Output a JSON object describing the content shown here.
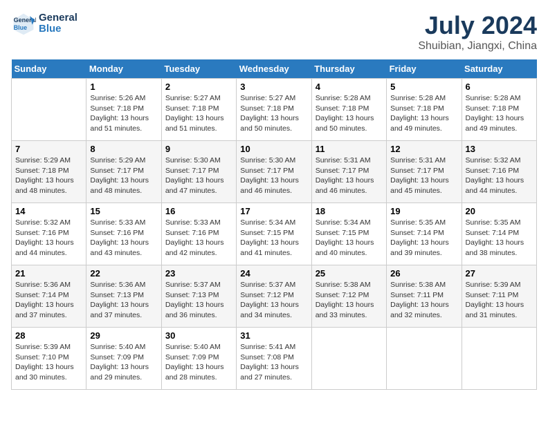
{
  "header": {
    "logo_line1": "General",
    "logo_line2": "Blue",
    "title": "July 2024",
    "subtitle": "Shuibian, Jiangxi, China"
  },
  "weekdays": [
    "Sunday",
    "Monday",
    "Tuesday",
    "Wednesday",
    "Thursday",
    "Friday",
    "Saturday"
  ],
  "weeks": [
    [
      null,
      {
        "day": "1",
        "sunrise": "5:26 AM",
        "sunset": "7:18 PM",
        "daylight": "13 hours and 51 minutes."
      },
      {
        "day": "2",
        "sunrise": "5:27 AM",
        "sunset": "7:18 PM",
        "daylight": "13 hours and 51 minutes."
      },
      {
        "day": "3",
        "sunrise": "5:27 AM",
        "sunset": "7:18 PM",
        "daylight": "13 hours and 50 minutes."
      },
      {
        "day": "4",
        "sunrise": "5:28 AM",
        "sunset": "7:18 PM",
        "daylight": "13 hours and 50 minutes."
      },
      {
        "day": "5",
        "sunrise": "5:28 AM",
        "sunset": "7:18 PM",
        "daylight": "13 hours and 49 minutes."
      },
      {
        "day": "6",
        "sunrise": "5:28 AM",
        "sunset": "7:18 PM",
        "daylight": "13 hours and 49 minutes."
      }
    ],
    [
      {
        "day": "7",
        "sunrise": "5:29 AM",
        "sunset": "7:18 PM",
        "daylight": "13 hours and 48 minutes."
      },
      {
        "day": "8",
        "sunrise": "5:29 AM",
        "sunset": "7:17 PM",
        "daylight": "13 hours and 48 minutes."
      },
      {
        "day": "9",
        "sunrise": "5:30 AM",
        "sunset": "7:17 PM",
        "daylight": "13 hours and 47 minutes."
      },
      {
        "day": "10",
        "sunrise": "5:30 AM",
        "sunset": "7:17 PM",
        "daylight": "13 hours and 46 minutes."
      },
      {
        "day": "11",
        "sunrise": "5:31 AM",
        "sunset": "7:17 PM",
        "daylight": "13 hours and 46 minutes."
      },
      {
        "day": "12",
        "sunrise": "5:31 AM",
        "sunset": "7:17 PM",
        "daylight": "13 hours and 45 minutes."
      },
      {
        "day": "13",
        "sunrise": "5:32 AM",
        "sunset": "7:16 PM",
        "daylight": "13 hours and 44 minutes."
      }
    ],
    [
      {
        "day": "14",
        "sunrise": "5:32 AM",
        "sunset": "7:16 PM",
        "daylight": "13 hours and 44 minutes."
      },
      {
        "day": "15",
        "sunrise": "5:33 AM",
        "sunset": "7:16 PM",
        "daylight": "13 hours and 43 minutes."
      },
      {
        "day": "16",
        "sunrise": "5:33 AM",
        "sunset": "7:16 PM",
        "daylight": "13 hours and 42 minutes."
      },
      {
        "day": "17",
        "sunrise": "5:34 AM",
        "sunset": "7:15 PM",
        "daylight": "13 hours and 41 minutes."
      },
      {
        "day": "18",
        "sunrise": "5:34 AM",
        "sunset": "7:15 PM",
        "daylight": "13 hours and 40 minutes."
      },
      {
        "day": "19",
        "sunrise": "5:35 AM",
        "sunset": "7:14 PM",
        "daylight": "13 hours and 39 minutes."
      },
      {
        "day": "20",
        "sunrise": "5:35 AM",
        "sunset": "7:14 PM",
        "daylight": "13 hours and 38 minutes."
      }
    ],
    [
      {
        "day": "21",
        "sunrise": "5:36 AM",
        "sunset": "7:14 PM",
        "daylight": "13 hours and 37 minutes."
      },
      {
        "day": "22",
        "sunrise": "5:36 AM",
        "sunset": "7:13 PM",
        "daylight": "13 hours and 37 minutes."
      },
      {
        "day": "23",
        "sunrise": "5:37 AM",
        "sunset": "7:13 PM",
        "daylight": "13 hours and 36 minutes."
      },
      {
        "day": "24",
        "sunrise": "5:37 AM",
        "sunset": "7:12 PM",
        "daylight": "13 hours and 34 minutes."
      },
      {
        "day": "25",
        "sunrise": "5:38 AM",
        "sunset": "7:12 PM",
        "daylight": "13 hours and 33 minutes."
      },
      {
        "day": "26",
        "sunrise": "5:38 AM",
        "sunset": "7:11 PM",
        "daylight": "13 hours and 32 minutes."
      },
      {
        "day": "27",
        "sunrise": "5:39 AM",
        "sunset": "7:11 PM",
        "daylight": "13 hours and 31 minutes."
      }
    ],
    [
      {
        "day": "28",
        "sunrise": "5:39 AM",
        "sunset": "7:10 PM",
        "daylight": "13 hours and 30 minutes."
      },
      {
        "day": "29",
        "sunrise": "5:40 AM",
        "sunset": "7:09 PM",
        "daylight": "13 hours and 29 minutes."
      },
      {
        "day": "30",
        "sunrise": "5:40 AM",
        "sunset": "7:09 PM",
        "daylight": "13 hours and 28 minutes."
      },
      {
        "day": "31",
        "sunrise": "5:41 AM",
        "sunset": "7:08 PM",
        "daylight": "13 hours and 27 minutes."
      },
      null,
      null,
      null
    ]
  ]
}
